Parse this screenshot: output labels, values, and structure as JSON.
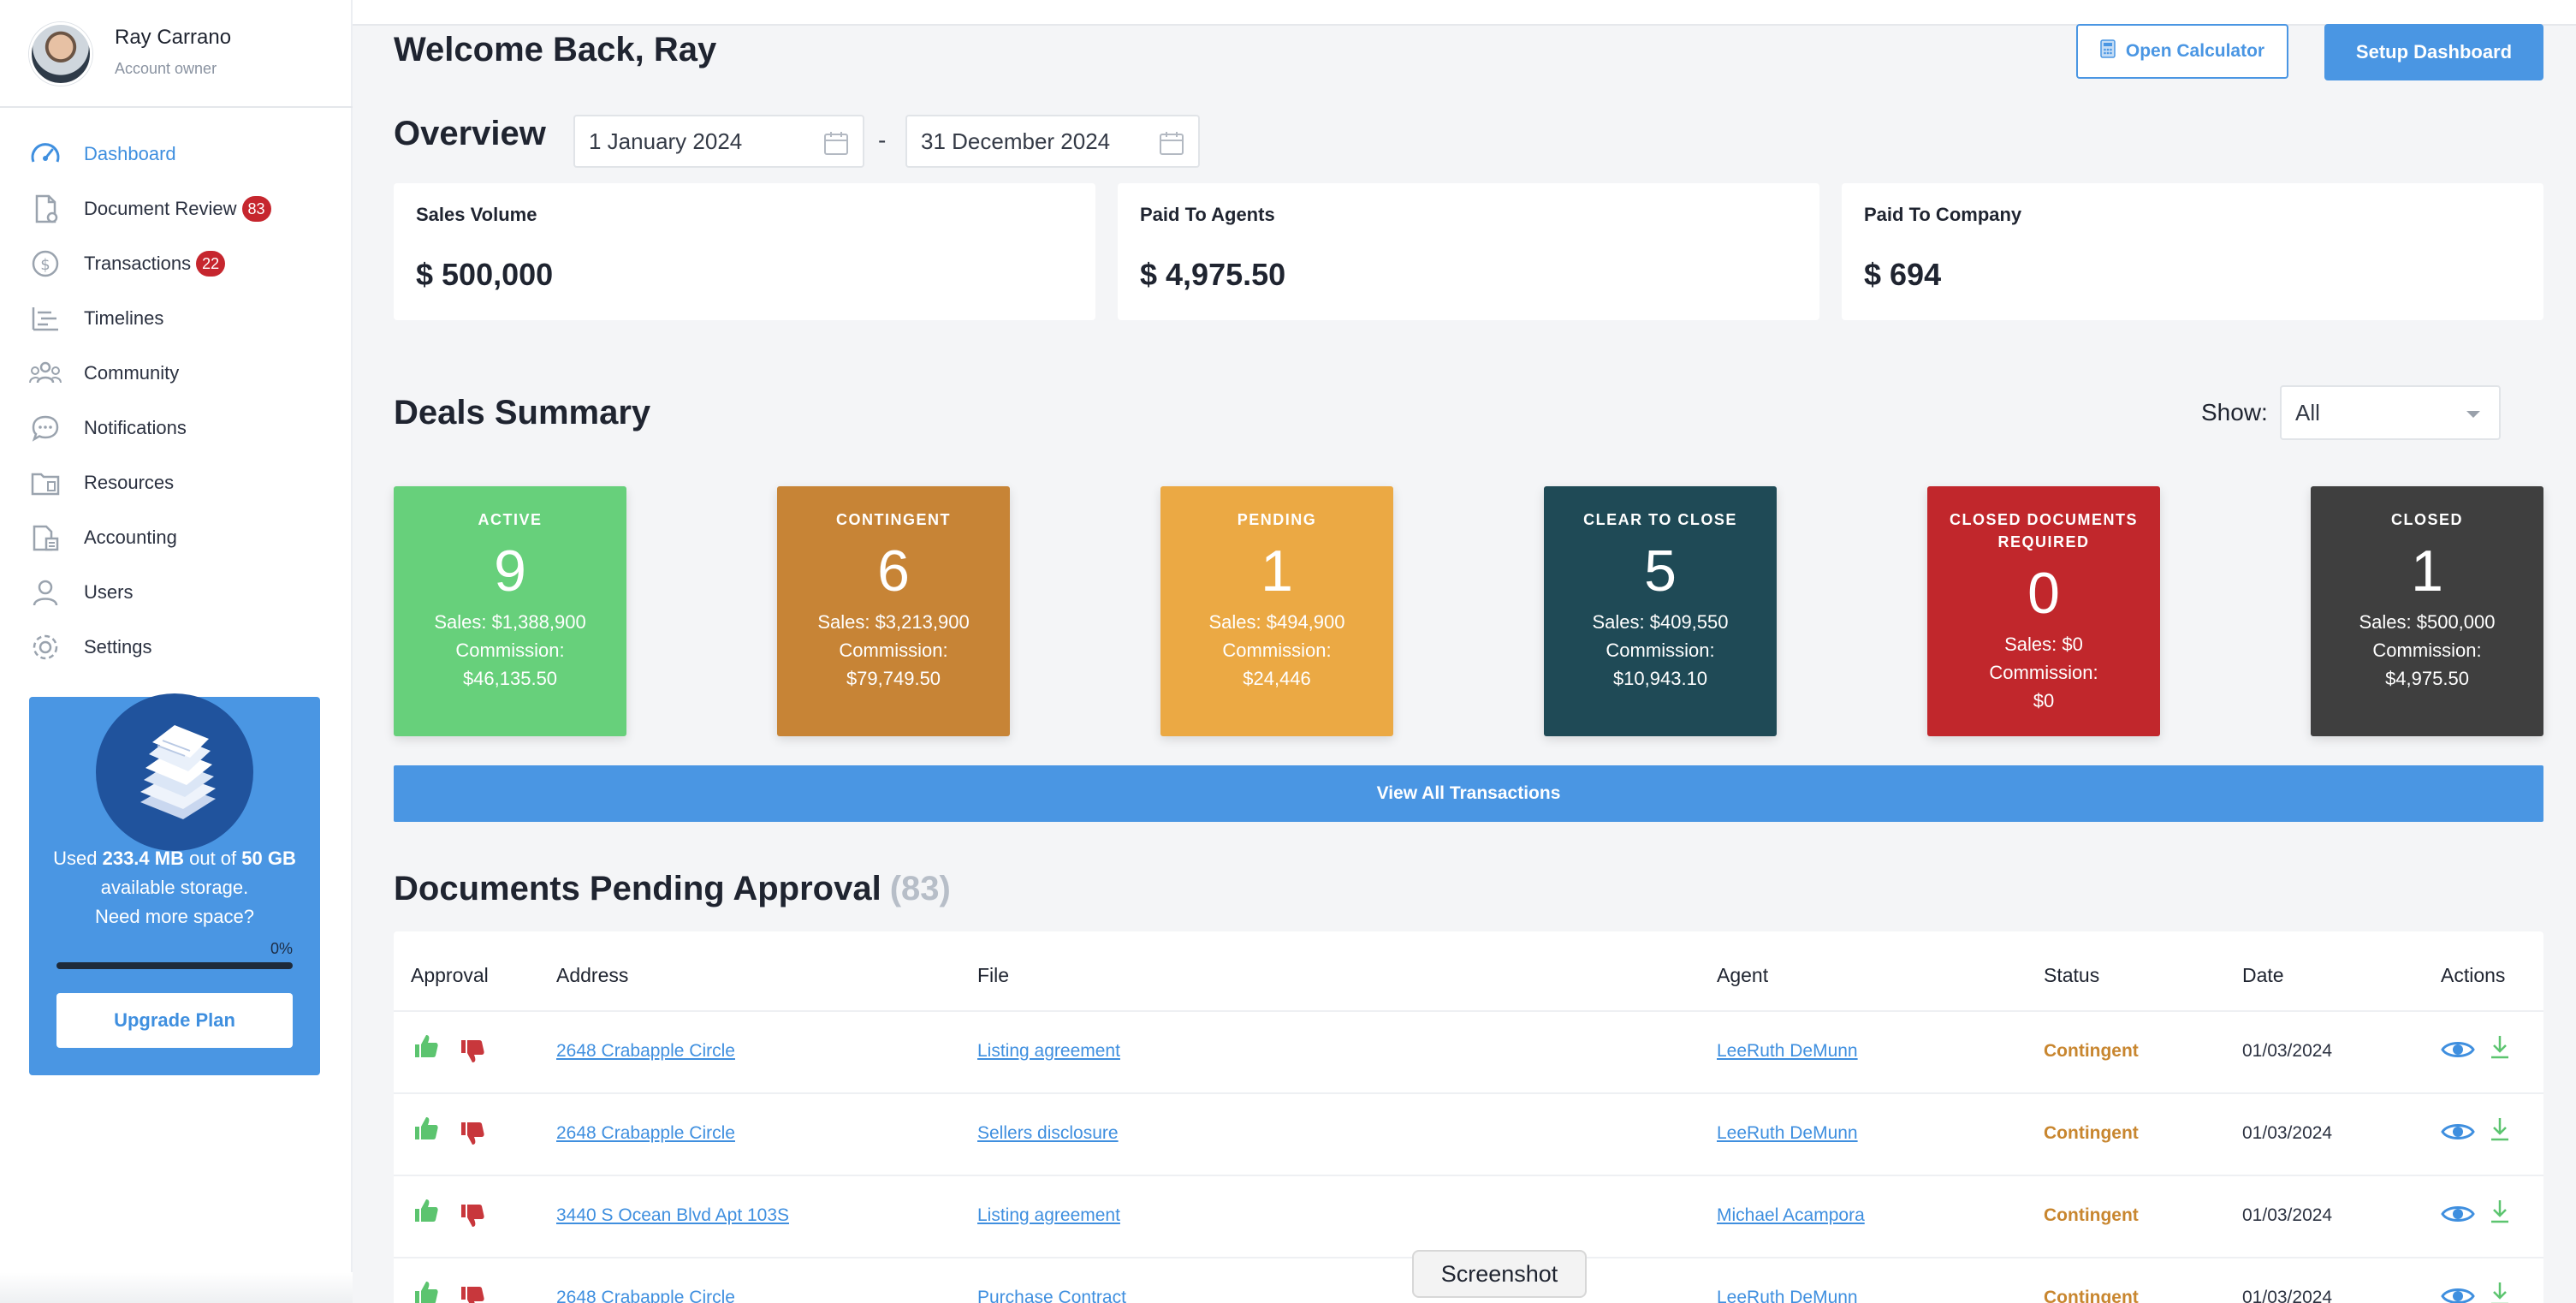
{
  "profile": {
    "name": "Ray Carrano",
    "role": "Account owner"
  },
  "nav": [
    {
      "label": "Dashboard",
      "icon": "gauge-icon",
      "active": true
    },
    {
      "label": "Document Review",
      "icon": "document-icon",
      "badge": "83"
    },
    {
      "label": "Transactions",
      "icon": "dollar-icon",
      "badge": "22"
    },
    {
      "label": "Timelines",
      "icon": "timeline-icon"
    },
    {
      "label": "Community",
      "icon": "community-icon"
    },
    {
      "label": "Notifications",
      "icon": "chat-bubble-icon"
    },
    {
      "label": "Resources",
      "icon": "folder-icon"
    },
    {
      "label": "Accounting",
      "icon": "accounting-icon"
    },
    {
      "label": "Users",
      "icon": "user-icon"
    },
    {
      "label": "Settings",
      "icon": "gear-icon"
    }
  ],
  "storage": {
    "used_prefix": "Used",
    "used": "233.4 MB",
    "mid": "out of",
    "total": "50 GB",
    "suffix": "available storage.",
    "more": "Need more space?",
    "percent": "0%",
    "fill_fraction": 0,
    "upgrade_label": "Upgrade Plan"
  },
  "header": {
    "welcome": "Welcome Back, Ray",
    "calc_label": "Open Calculator",
    "setup_label": "Setup Dashboard"
  },
  "overview": {
    "title": "Overview",
    "date_from": "1 January 2024",
    "date_sep": "-",
    "date_to": "31 December 2024"
  },
  "kpis": [
    {
      "label": "Sales Volume",
      "value": "$ 500,000"
    },
    {
      "label": "Paid To Agents",
      "value": "$ 4,975.50"
    },
    {
      "label": "Paid To Company",
      "value": "$ 694"
    }
  ],
  "deals": {
    "title": "Deals Summary",
    "show_label": "Show:",
    "show_value": "All",
    "cards": [
      {
        "title": "ACTIVE",
        "count": "9",
        "sales": "Sales: $1,388,900",
        "commission_label": "Commission:",
        "commission": "$46,135.50",
        "color": "#67d07b"
      },
      {
        "title": "CONTINGENT",
        "count": "6",
        "sales": "Sales: $3,213,900",
        "commission_label": "Commission:",
        "commission": "$79,749.50",
        "color": "#c78436"
      },
      {
        "title": "PENDING",
        "count": "1",
        "sales": "Sales: $494,900",
        "commission_label": "Commission:",
        "commission": "$24,446",
        "color": "#eba944"
      },
      {
        "title": "CLEAR TO CLOSE",
        "count": "5",
        "sales": "Sales: $409,550",
        "commission_label": "Commission:",
        "commission": "$10,943.10",
        "color": "#1f4a56"
      },
      {
        "title": "CLOSED DOCUMENTS REQUIRED",
        "count": "0",
        "sales": "Sales: $0",
        "commission_label": "Commission:",
        "commission": "$0",
        "color": "#c1272c"
      },
      {
        "title": "CLOSED",
        "count": "1",
        "sales": "Sales: $500,000",
        "commission_label": "Commission:",
        "commission": "$4,975.50",
        "color": "#3f3f3f"
      }
    ],
    "view_all_label": "View All Transactions"
  },
  "documents": {
    "title": "Documents Pending Approval",
    "count": "(83)",
    "columns": [
      "Approval",
      "Address",
      "File",
      "Agent",
      "Status",
      "Date",
      "Actions"
    ],
    "rows": [
      {
        "address": "2648 Crabapple Circle",
        "file": "Listing agreement",
        "agent": "LeeRuth DeMunn",
        "status": "Contingent",
        "date": "01/03/2024"
      },
      {
        "address": "2648 Crabapple Circle",
        "file": "Sellers disclosure",
        "agent": "LeeRuth DeMunn",
        "status": "Contingent",
        "date": "01/03/2024"
      },
      {
        "address": "3440 S Ocean Blvd Apt 103S",
        "file": "Listing agreement",
        "agent": "Michael Acampora",
        "status": "Contingent",
        "date": "01/03/2024"
      },
      {
        "address": "2648 Crabapple Circle",
        "file": "Purchase Contract",
        "agent": "LeeRuth DeMunn",
        "status": "Contingent",
        "date": "01/03/2024"
      }
    ]
  },
  "tooltip": "Screenshot",
  "colors": {
    "primary": "#4a96e3",
    "approve": "#5cc46f",
    "reject": "#c8373c",
    "badge": "#c6262e",
    "status": "#c8862f"
  }
}
